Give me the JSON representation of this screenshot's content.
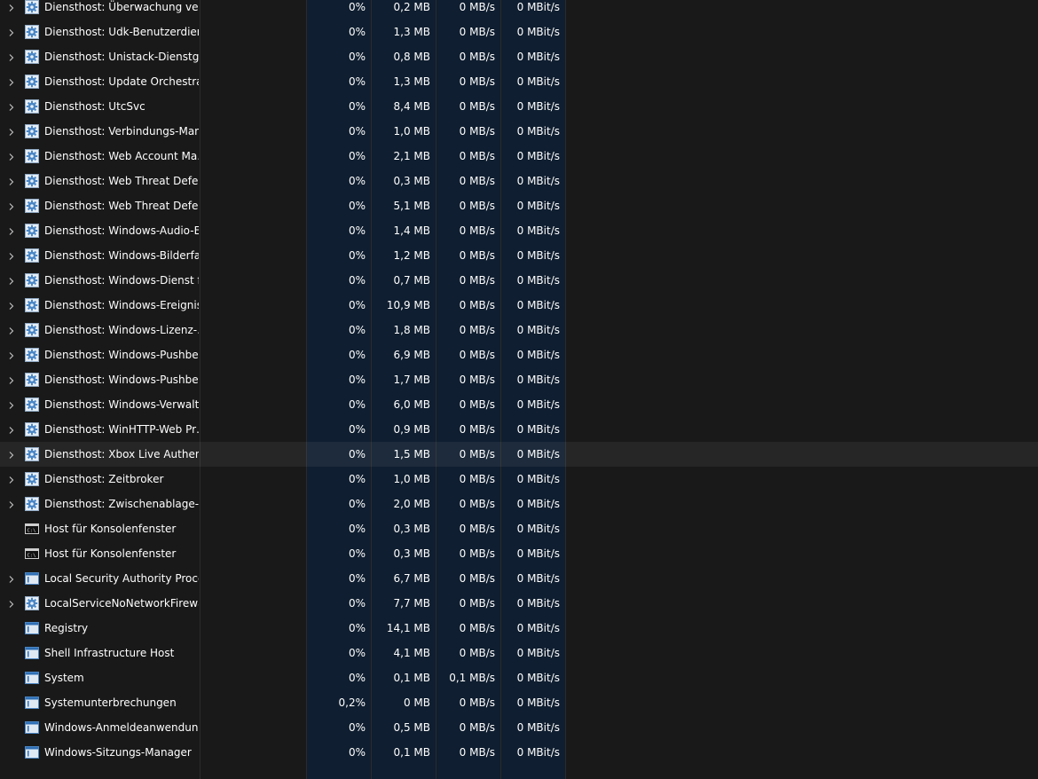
{
  "colors": {
    "background": "#191919",
    "highlighted_column_bg": "#0f1e30",
    "hover_row_bg": "#262626",
    "gear_icon_fg": "#5b9bd5",
    "text": "#ffffff"
  },
  "processes": [
    {
      "name": "Diensthost: Überwachung vert…",
      "icon": "gear-icon",
      "expandable": true,
      "cpu": "0%",
      "memory": "0,2 MB",
      "disk": "0 MB/s",
      "network": "0 MBit/s"
    },
    {
      "name": "Diensthost: Udk-Benutzerdien…",
      "icon": "gear-icon",
      "expandable": true,
      "cpu": "0%",
      "memory": "1,3 MB",
      "disk": "0 MB/s",
      "network": "0 MBit/s"
    },
    {
      "name": "Diensthost: Unistack-Dienstgr…",
      "icon": "gear-icon",
      "expandable": true,
      "cpu": "0%",
      "memory": "0,8 MB",
      "disk": "0 MB/s",
      "network": "0 MBit/s"
    },
    {
      "name": "Diensthost: Update Orchestrat…",
      "icon": "gear-icon",
      "expandable": true,
      "cpu": "0%",
      "memory": "1,3 MB",
      "disk": "0 MB/s",
      "network": "0 MBit/s"
    },
    {
      "name": "Diensthost: UtcSvc",
      "icon": "gear-icon",
      "expandable": true,
      "cpu": "0%",
      "memory": "8,4 MB",
      "disk": "0 MB/s",
      "network": "0 MBit/s"
    },
    {
      "name": "Diensthost: Verbindungs-Man…",
      "icon": "gear-icon",
      "expandable": true,
      "cpu": "0%",
      "memory": "1,0 MB",
      "disk": "0 MB/s",
      "network": "0 MBit/s"
    },
    {
      "name": "Diensthost: Web Account Ma…",
      "icon": "gear-icon",
      "expandable": true,
      "cpu": "0%",
      "memory": "2,1 MB",
      "disk": "0 MB/s",
      "network": "0 MBit/s"
    },
    {
      "name": "Diensthost: Web Threat Defen…",
      "icon": "gear-icon",
      "expandable": true,
      "cpu": "0%",
      "memory": "0,3 MB",
      "disk": "0 MB/s",
      "network": "0 MBit/s"
    },
    {
      "name": "Diensthost: Web Threat Defen…",
      "icon": "gear-icon",
      "expandable": true,
      "cpu": "0%",
      "memory": "5,1 MB",
      "disk": "0 MB/s",
      "network": "0 MBit/s"
    },
    {
      "name": "Diensthost: Windows-Audio-E…",
      "icon": "gear-icon",
      "expandable": true,
      "cpu": "0%",
      "memory": "1,4 MB",
      "disk": "0 MB/s",
      "network": "0 MBit/s"
    },
    {
      "name": "Diensthost: Windows-Bilderfa…",
      "icon": "gear-icon",
      "expandable": true,
      "cpu": "0%",
      "memory": "1,2 MB",
      "disk": "0 MB/s",
      "network": "0 MBit/s"
    },
    {
      "name": "Diensthost: Windows-Dienst f…",
      "icon": "gear-icon",
      "expandable": true,
      "cpu": "0%",
      "memory": "0,7 MB",
      "disk": "0 MB/s",
      "network": "0 MBit/s"
    },
    {
      "name": "Diensthost: Windows-Ereignis…",
      "icon": "gear-icon",
      "expandable": true,
      "cpu": "0%",
      "memory": "10,9 MB",
      "disk": "0 MB/s",
      "network": "0 MBit/s"
    },
    {
      "name": "Diensthost: Windows-Lizenz-…",
      "icon": "gear-icon",
      "expandable": true,
      "cpu": "0%",
      "memory": "1,8 MB",
      "disk": "0 MB/s",
      "network": "0 MBit/s"
    },
    {
      "name": "Diensthost: Windows-Pushbe…",
      "icon": "gear-icon",
      "expandable": true,
      "cpu": "0%",
      "memory": "6,9 MB",
      "disk": "0 MB/s",
      "network": "0 MBit/s"
    },
    {
      "name": "Diensthost: Windows-Pushbe…",
      "icon": "gear-icon",
      "expandable": true,
      "cpu": "0%",
      "memory": "1,7 MB",
      "disk": "0 MB/s",
      "network": "0 MBit/s"
    },
    {
      "name": "Diensthost: Windows-Verwalt…",
      "icon": "gear-icon",
      "expandable": true,
      "cpu": "0%",
      "memory": "6,0 MB",
      "disk": "0 MB/s",
      "network": "0 MBit/s"
    },
    {
      "name": "Diensthost: WinHTTP-Web Pr…",
      "icon": "gear-icon",
      "expandable": true,
      "cpu": "0%",
      "memory": "0,9 MB",
      "disk": "0 MB/s",
      "network": "0 MBit/s"
    },
    {
      "name": "Diensthost: Xbox Live Authent…",
      "icon": "gear-icon",
      "expandable": true,
      "hover": true,
      "cpu": "0%",
      "memory": "1,5 MB",
      "disk": "0 MB/s",
      "network": "0 MBit/s"
    },
    {
      "name": "Diensthost: Zeitbroker",
      "icon": "gear-icon",
      "expandable": true,
      "cpu": "0%",
      "memory": "1,0 MB",
      "disk": "0 MB/s",
      "network": "0 MBit/s"
    },
    {
      "name": "Diensthost: Zwischenablage-B…",
      "icon": "gear-icon",
      "expandable": true,
      "cpu": "0%",
      "memory": "2,0 MB",
      "disk": "0 MB/s",
      "network": "0 MBit/s"
    },
    {
      "name": "Host für Konsolenfenster",
      "icon": "console-icon",
      "expandable": false,
      "cpu": "0%",
      "memory": "0,3 MB",
      "disk": "0 MB/s",
      "network": "0 MBit/s"
    },
    {
      "name": "Host für Konsolenfenster",
      "icon": "console-icon",
      "expandable": false,
      "cpu": "0%",
      "memory": "0,3 MB",
      "disk": "0 MB/s",
      "network": "0 MBit/s"
    },
    {
      "name": "Local Security Authority Proce…",
      "icon": "window-icon",
      "expandable": true,
      "cpu": "0%",
      "memory": "6,7 MB",
      "disk": "0 MB/s",
      "network": "0 MBit/s"
    },
    {
      "name": "LocalServiceNoNetworkFirewa…",
      "icon": "gear-icon",
      "expandable": true,
      "cpu": "0%",
      "memory": "7,7 MB",
      "disk": "0 MB/s",
      "network": "0 MBit/s"
    },
    {
      "name": "Registry",
      "icon": "window-icon",
      "expandable": false,
      "cpu": "0%",
      "memory": "14,1 MB",
      "disk": "0 MB/s",
      "network": "0 MBit/s"
    },
    {
      "name": "Shell Infrastructure Host",
      "icon": "window-icon",
      "expandable": false,
      "cpu": "0%",
      "memory": "4,1 MB",
      "disk": "0 MB/s",
      "network": "0 MBit/s"
    },
    {
      "name": "System",
      "icon": "window-icon",
      "expandable": false,
      "cpu": "0%",
      "memory": "0,1 MB",
      "disk": "0,1 MB/s",
      "network": "0 MBit/s"
    },
    {
      "name": "Systemunterbrechungen",
      "icon": "window-icon",
      "expandable": false,
      "cpu": "0,2%",
      "memory": "0 MB",
      "disk": "0 MB/s",
      "network": "0 MBit/s"
    },
    {
      "name": "Windows-Anmeldeanwendung",
      "icon": "window-icon",
      "expandable": false,
      "cpu": "0%",
      "memory": "0,5 MB",
      "disk": "0 MB/s",
      "network": "0 MBit/s"
    },
    {
      "name": "Windows-Sitzungs-Manager",
      "icon": "window-icon",
      "expandable": false,
      "cpu": "0%",
      "memory": "0,1 MB",
      "disk": "0 MB/s",
      "network": "0 MBit/s"
    }
  ]
}
